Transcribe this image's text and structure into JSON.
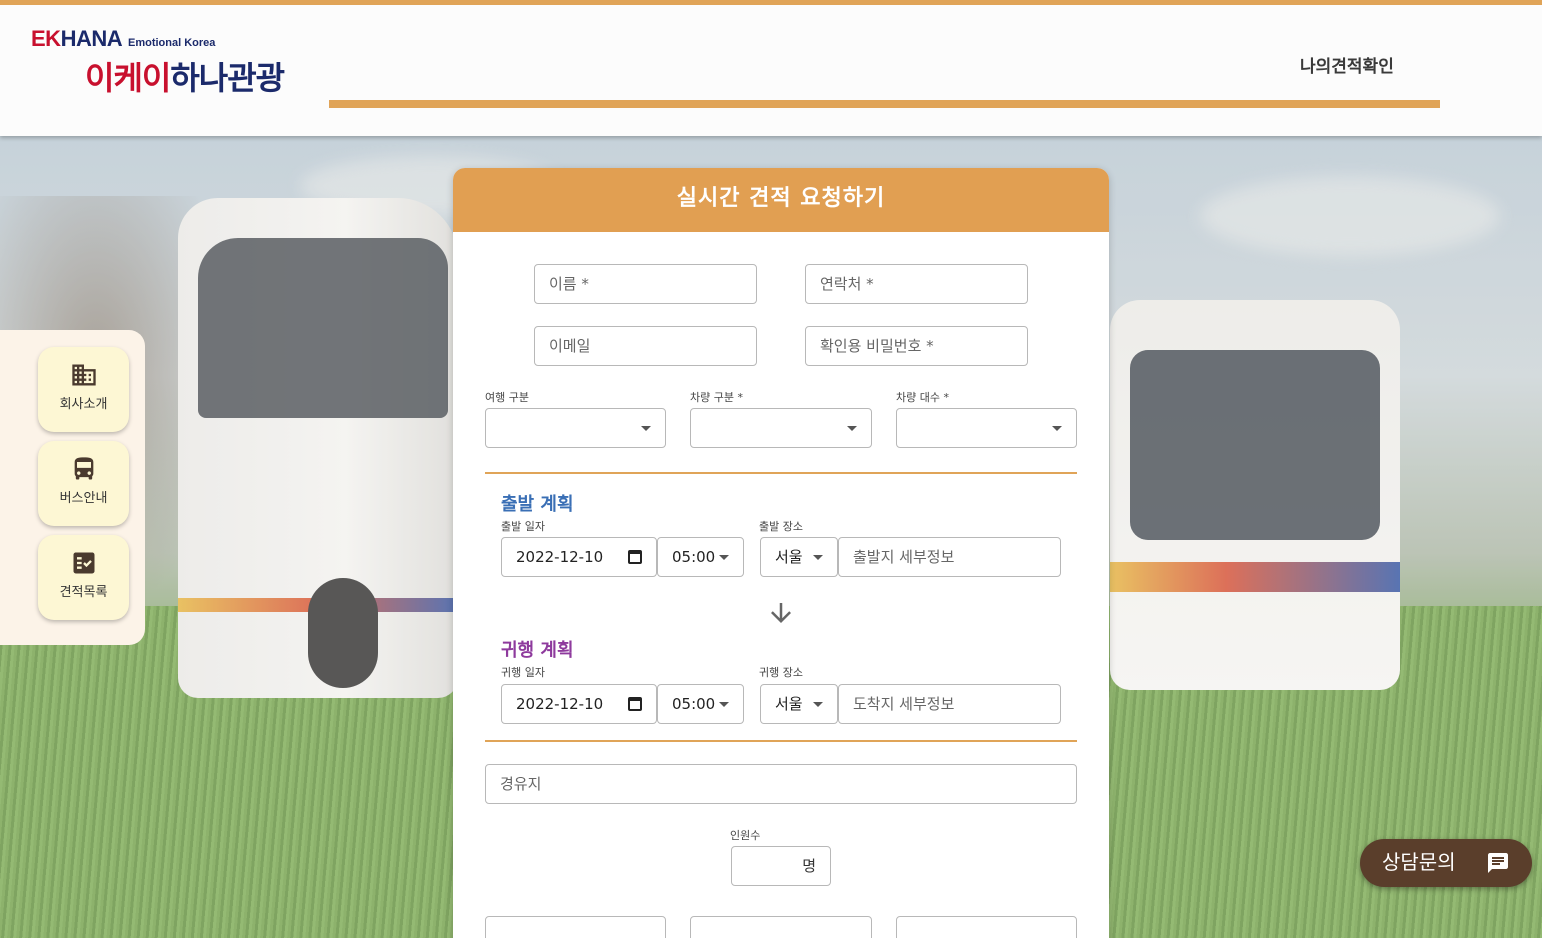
{
  "brand": {
    "en_ek": "EK",
    "en_hana": "HANA",
    "en_sub": "Emotional Korea",
    "kr_a": "이케이",
    "kr_b": "하나관광"
  },
  "nav": {
    "my_quote": "나의견적확인"
  },
  "sidebar": {
    "items": [
      {
        "label": "회사소개",
        "icon": "building-icon"
      },
      {
        "label": "버스안내",
        "icon": "bus-icon"
      },
      {
        "label": "견적목록",
        "icon": "checklist-icon"
      }
    ]
  },
  "form": {
    "title": "실시간 견적 요청하기",
    "name_placeholder": "이름 *",
    "phone_placeholder": "연락처 *",
    "email_placeholder": "이메일",
    "password_placeholder": "확인용 비밀번호 *",
    "trip_type_label": "여행 구분",
    "vehicle_type_label": "차량 구분 *",
    "vehicle_count_label": "차량 대수 *",
    "departure": {
      "section_title": "출발 계획",
      "date_label": "출발 일자",
      "date_value": "2022-12-10",
      "time_value": "05:00",
      "place_label": "출발 장소",
      "region_value": "서울",
      "detail_placeholder": "출발지 세부정보"
    },
    "return": {
      "section_title": "귀행 계획",
      "date_label": "귀행 일자",
      "date_value": "2022-12-10",
      "time_value": "05:00",
      "place_label": "귀행 장소",
      "region_value": "서울",
      "detail_placeholder": "도착지 세부정보"
    },
    "waypoint_placeholder": "경유지",
    "headcount_label": "인원수",
    "headcount_unit": "명"
  },
  "chat": {
    "label": "상담문의"
  },
  "colors": {
    "accent": "#e0a458",
    "header_orange": "#e19f52",
    "departure_title": "#3a6fb5",
    "return_title": "#8e3a9d",
    "chat_bg": "#5a3e2b"
  }
}
